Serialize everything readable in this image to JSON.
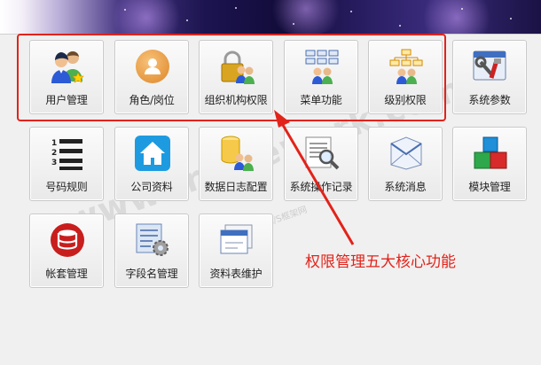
{
  "tiles": {
    "user_mgmt": {
      "label": "用户管理",
      "icon": "users-icon"
    },
    "role_post": {
      "label": "角色/岗位",
      "icon": "person-circle-icon"
    },
    "org_perm": {
      "label": "组织机构权限",
      "icon": "lock-users-icon"
    },
    "menu_func": {
      "label": "菜单功能",
      "icon": "menu-tree-icon"
    },
    "level_perm": {
      "label": "级别权限",
      "icon": "hierarchy-icon"
    },
    "sys_params": {
      "label": "系统参数",
      "icon": "tools-icon"
    },
    "number_rules": {
      "label": "号码规则",
      "icon": "numbered-list-icon"
    },
    "company_info": {
      "label": "公司资料",
      "icon": "home-icon"
    },
    "data_log": {
      "label": "数据日志配置",
      "icon": "database-users-icon"
    },
    "op_log": {
      "label": "系统操作记录",
      "icon": "document-search-icon"
    },
    "sys_msg": {
      "label": "系统消息",
      "icon": "envelope-icon"
    },
    "module_mgmt": {
      "label": "模块管理",
      "icon": "cubes-icon"
    },
    "account_set": {
      "label": "帐套管理",
      "icon": "database-icon"
    },
    "field_names": {
      "label": "字段名管理",
      "icon": "form-gear-icon"
    },
    "table_maint": {
      "label": "资料表维护",
      "icon": "window-icon"
    }
  },
  "annotation": {
    "text": "权限管理五大核心功能",
    "color": "#e2231a"
  },
  "watermark": {
    "main": "www.framework.com",
    "sub": "C/S框架网"
  },
  "colors": {
    "highlight": "#e2231a",
    "tile_border": "#c9c9c9"
  }
}
